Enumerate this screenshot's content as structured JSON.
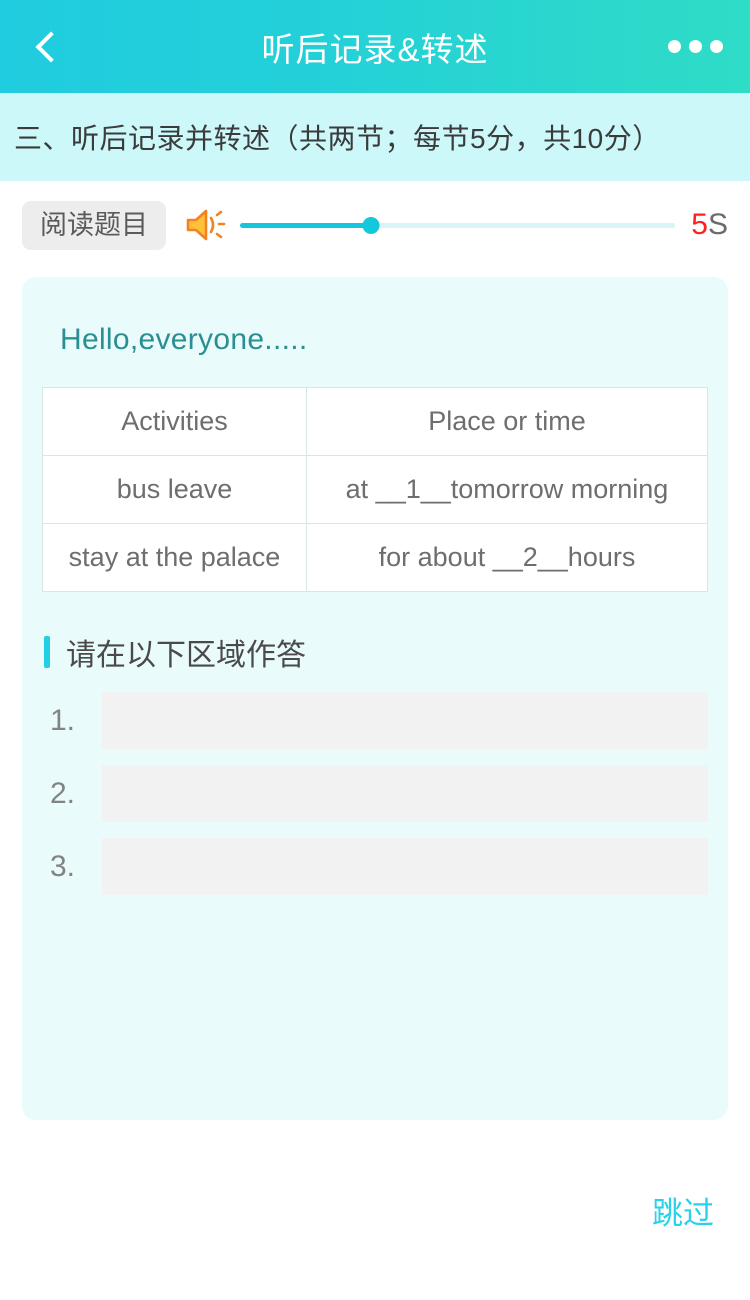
{
  "header": {
    "title": "听后记录&转述",
    "back_icon": "chevron-left-icon",
    "more_icon": "more-dots-icon"
  },
  "subheader": {
    "text": "三、听后记录并转述（共两节；每节5分，共10分）"
  },
  "audio_bar": {
    "read_button_label": "阅读题目",
    "speaker_icon": "speaker-sound-icon",
    "progress_percent": 30,
    "timer_value": "5",
    "timer_unit": "S",
    "timer_color": "#ff2020"
  },
  "content": {
    "greeting": "Hello,everyone.....",
    "table": {
      "headers": [
        "Activities",
        "Place or time"
      ],
      "rows": [
        [
          "bus leave",
          "at __1__tomorrow morning"
        ],
        [
          "stay at the palace",
          "for about __2__hours"
        ]
      ]
    },
    "answer_section_title": "请在以下区域作答",
    "answers": [
      {
        "number": "1.",
        "value": "",
        "placeholder": ""
      },
      {
        "number": "2.",
        "value": "",
        "placeholder": ""
      },
      {
        "number": "3.",
        "value": "",
        "placeholder": ""
      }
    ]
  },
  "footer": {
    "skip_label": "跳过"
  },
  "colors": {
    "header_gradient_start": "#20ccdf",
    "header_gradient_end": "#2fdcc6",
    "subbar_bg": "#ccf8fa",
    "card_bg": "#eafbfc",
    "accent": "#22cfe2",
    "speaker_orange": "#f58220",
    "speaker_yellow": "#fdc23a"
  }
}
